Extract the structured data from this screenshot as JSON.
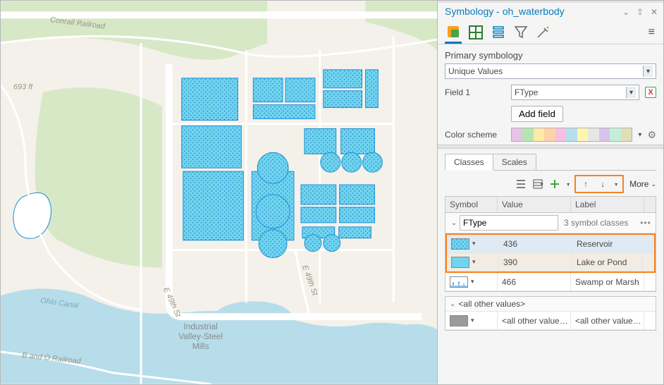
{
  "pane": {
    "title": "Symbology - oh_waterbody"
  },
  "primary": {
    "heading": "Primary symbology",
    "type": "Unique Values",
    "field1_label": "Field 1",
    "field1_value": "FType",
    "add_field_label": "Add field",
    "colorscheme_label": "Color scheme"
  },
  "colorscheme_colors": [
    "#e8c3e8",
    "#b7e5b2",
    "#ffe9a8",
    "#ffd3a8",
    "#f7bfe1",
    "#b4e0ec",
    "#fff5b0",
    "#e6e6e6",
    "#d7c3ec",
    "#c2f0d7",
    "#e0e0b8"
  ],
  "subtabs": {
    "classes": "Classes",
    "scales": "Scales"
  },
  "toolbar": {
    "more": "More"
  },
  "grid": {
    "headers": {
      "symbol": "Symbol",
      "value": "Value",
      "label": "Label"
    },
    "group_field": "FType",
    "group_count_text": "3 symbol classes",
    "rows": [
      {
        "value": "436",
        "label": "Reservoir",
        "swatch": "dotted"
      },
      {
        "value": "390",
        "label": "Lake or Pond",
        "swatch": "flat"
      },
      {
        "value": "466",
        "label": "Swamp or Marsh",
        "swatch": "marsh"
      }
    ],
    "all_other_heading": "<all other values>",
    "all_other_value": "<all other value…",
    "all_other_label": "<all other value…"
  },
  "map": {
    "elev": "693 ft",
    "rr1": "Conrail Railroad",
    "rr2": "B and O Railroad",
    "canal": "Ohio Canal",
    "st1": "E 49th St",
    "st2": "E 49th St",
    "place1": "Industrial",
    "place2": "Valley-Steel",
    "place3": "Mills"
  }
}
